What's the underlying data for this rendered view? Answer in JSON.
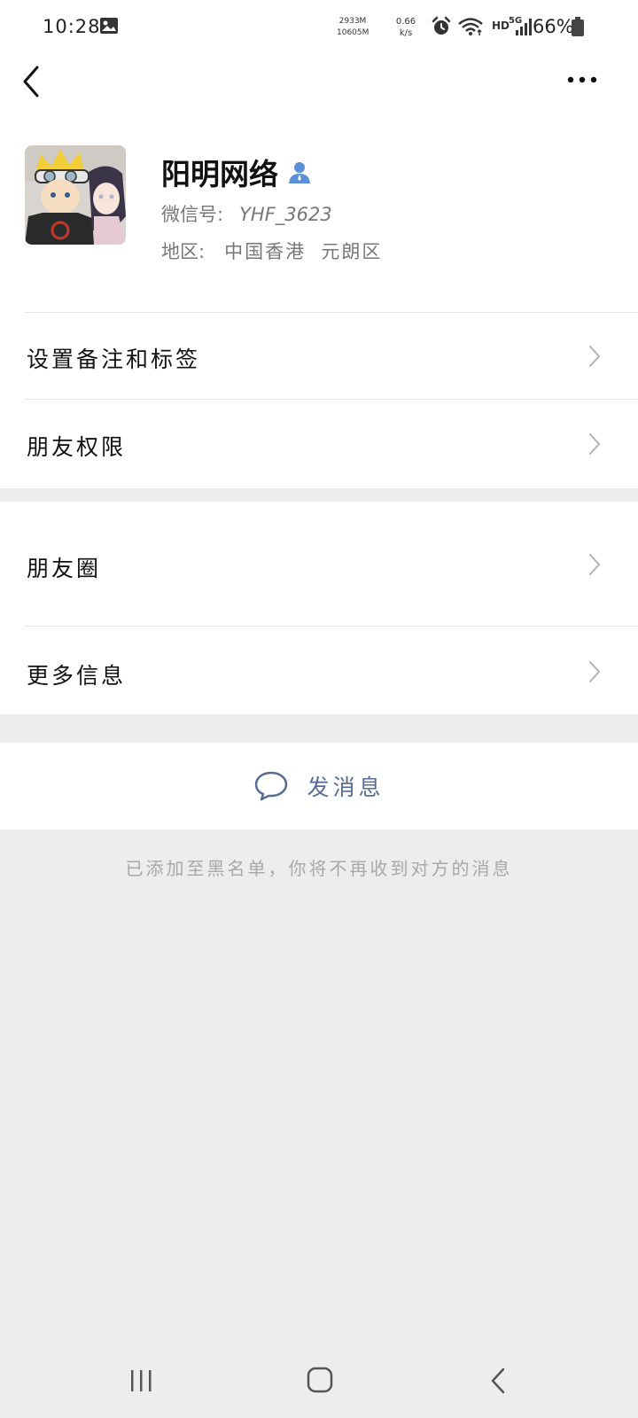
{
  "status_bar": {
    "time": "10:28",
    "mem_top": "2933M",
    "mem_bottom": "10605M",
    "speed_top": "0.66",
    "speed_bottom": "k/s",
    "hd": "HD",
    "network": "5G",
    "battery": "66%"
  },
  "profile": {
    "name": "阳明网络",
    "wechat_id_label": "微信号:",
    "wechat_id": "YHF_3623",
    "region_label": "地区:",
    "region": "中国香港  元朗区"
  },
  "menu": {
    "remark_tags": "设置备注和标签",
    "friend_permissions": "朋友权限",
    "moments": "朋友圈",
    "more_info": "更多信息"
  },
  "actions": {
    "send_message": "发消息"
  },
  "notice": {
    "blocked": "已添加至黑名单，你将不再收到对方的消息"
  },
  "colors": {
    "link_blue": "#576b95",
    "contact_icon_blue": "#5b8fd9",
    "page_gray": "#ededed"
  }
}
